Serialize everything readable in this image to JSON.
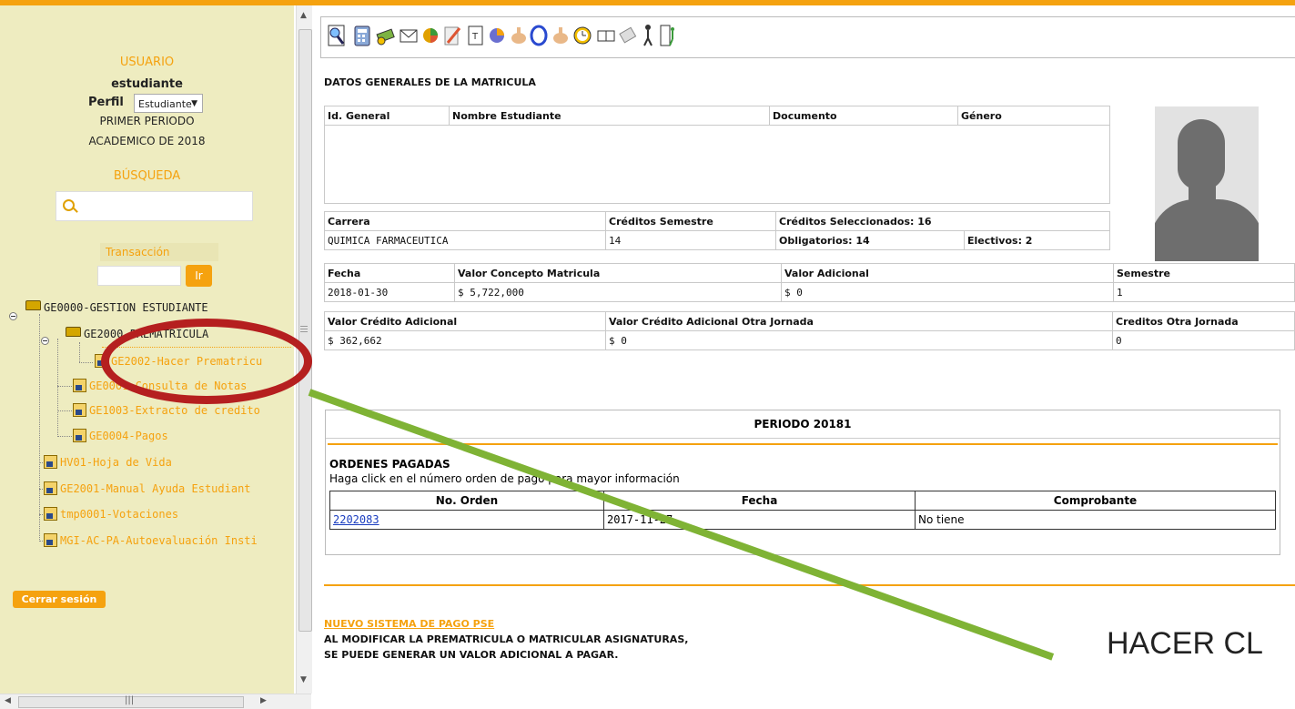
{
  "user": {
    "section_label": "USUARIO",
    "username": "estudiante",
    "perfil_label": "Perfil",
    "perfil_value": "Estudiante",
    "period_line1": "PRIMER PERIODO",
    "period_line2": "ACADEMICO DE 2018"
  },
  "search": {
    "label": "BÚSQUEDA",
    "placeholder": ""
  },
  "transaction": {
    "label": "Transacción",
    "button": "Ir"
  },
  "tree": {
    "root": "GE0000-GESTION ESTUDIANTE",
    "sub": "GE2000-PREMATRICULA",
    "items": [
      "GE2002-Hacer Prematricu",
      "GE0001-Consulta de Notas",
      "GE1003-Extracto de credito",
      "GE0004-Pagos",
      "HV01-Hoja de Vida",
      "GE2001-Manual Ayuda Estudiant",
      "tmp0001-Votaciones",
      "MGI-AC-PA-Autoevaluación Insti"
    ]
  },
  "logout_label": "Cerrar sesión",
  "toolbar_icons": [
    "search-doc-icon",
    "calculator-icon",
    "money-icon",
    "mail-icon",
    "pie-chart-icon",
    "pencil-icon",
    "text-doc-icon",
    "chart-icon",
    "hand-icon",
    "zero-icon",
    "hand-icon",
    "clock-icon",
    "book-icon",
    "tag-icon",
    "runner-icon",
    "exit-icon"
  ],
  "general": {
    "title": "DATOS GENERALES DE LA MATRICULA",
    "h_id": "Id. General",
    "h_nombre": "Nombre Estudiante",
    "h_doc": "Documento",
    "h_genero": "Género",
    "h_carrera": "Carrera",
    "h_cred_sem": "Créditos Semestre",
    "h_cred_sel": "Créditos Seleccionados: 16",
    "carrera": "QUIMICA FARMACEUTICA",
    "cred_sem": "14",
    "obligatorios": "Obligatorios: 14",
    "electivos": "Electivos: 2",
    "h_fecha": "Fecha",
    "h_valor_concepto": "Valor Concepto Matricula",
    "h_valor_adic": "Valor Adicional",
    "h_semestre": "Semestre",
    "fecha": "2018-01-30",
    "valor_concepto": "$ 5,722,000",
    "valor_adic": "$ 0",
    "semestre": "1",
    "h_vca": "Valor Crédito Adicional",
    "h_vcaoj": "Valor Crédito Adicional Otra Jornada",
    "h_coj": "Creditos Otra Jornada",
    "vca": "$ 362,662",
    "vcaoj": "$ 0",
    "coj": "0"
  },
  "periodo": {
    "title": "PERIODO 20181",
    "orders_title": "ORDENES PAGADAS",
    "orders_sub": "Haga click en el número orden de pago para mayor información",
    "h_orden": "No. Orden",
    "h_fecha": "Fecha",
    "h_comprobante": "Comprobante",
    "rows": [
      {
        "orden": "2202083",
        "fecha": "2017-11-27",
        "comprobante": "No tiene"
      }
    ]
  },
  "footer": {
    "pse_link": "NUEVO SISTEMA DE PAGO PSE",
    "note1": "AL MODIFICAR LA PREMATRICULA O MATRICULAR ASIGNATURAS,",
    "note2": "SE PUEDE GENERAR UN VALOR ADICIONAL A PAGAR."
  },
  "annotation": {
    "text": "HACER CL",
    "oval_color": "#b51f1f",
    "line_color": "#7fb335"
  },
  "colors": {
    "accent": "#f5a20f",
    "panel": "#eeecc0"
  }
}
